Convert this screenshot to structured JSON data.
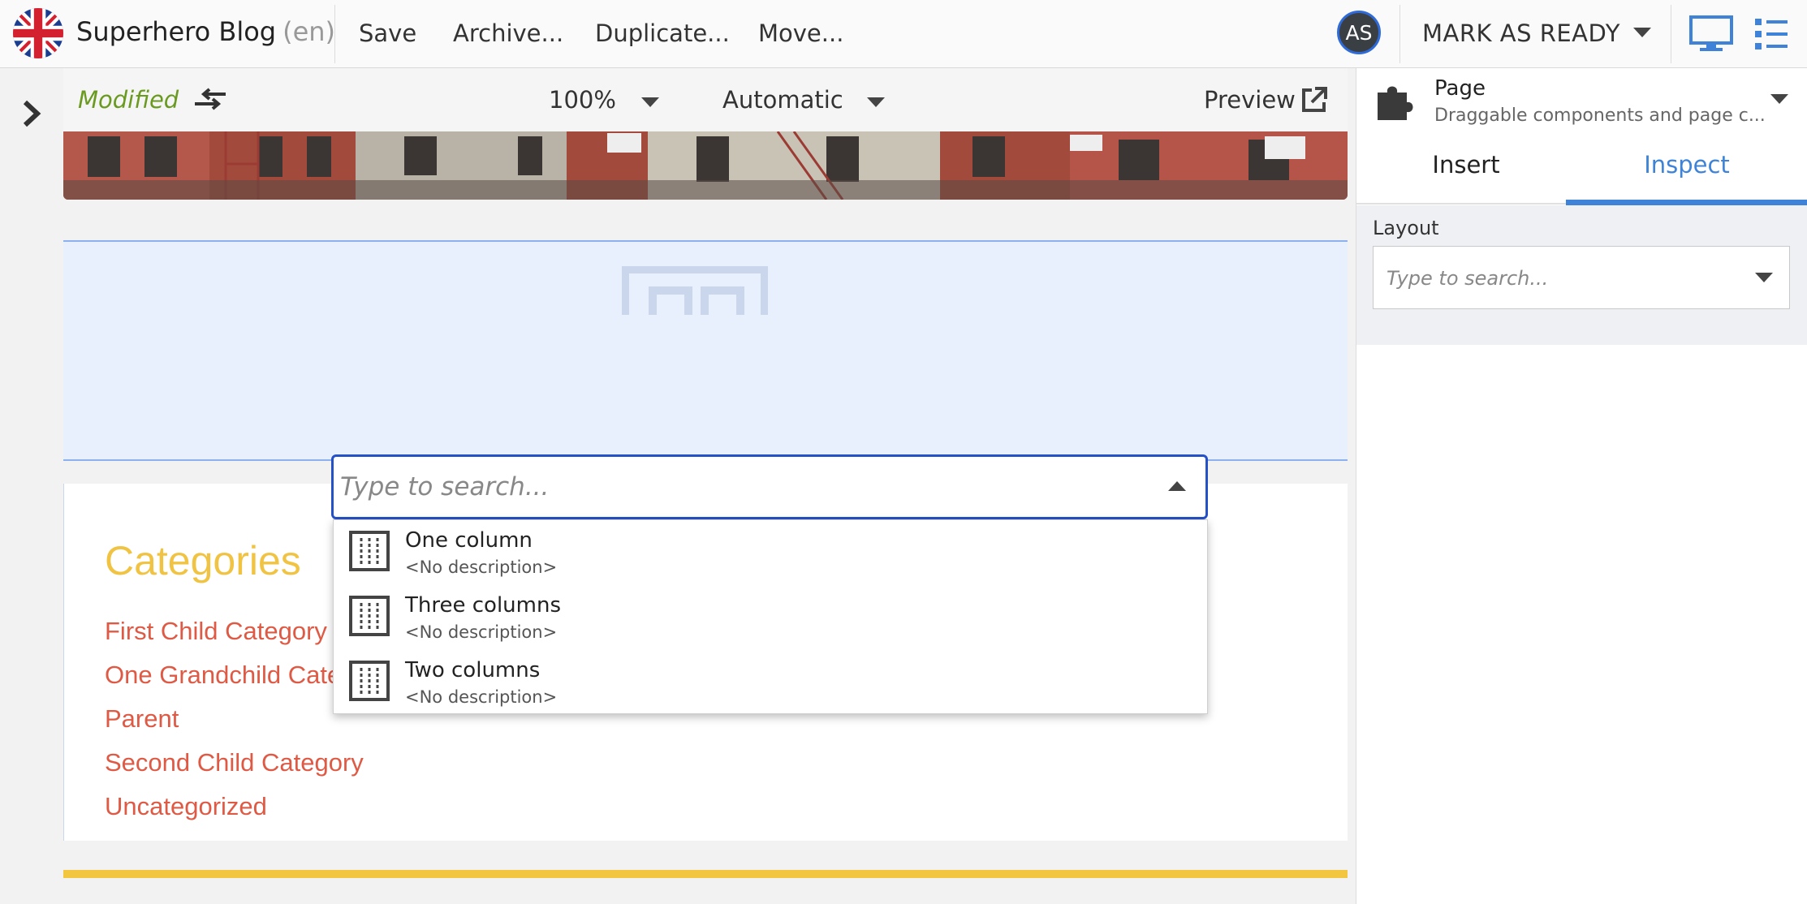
{
  "header": {
    "site_title": "Superhero Blog",
    "site_lang": "(en)",
    "actions": {
      "save": "Save",
      "archive": "Archive...",
      "duplicate": "Duplicate...",
      "move": "Move..."
    },
    "avatar_initials": "AS",
    "mark_ready": "MARK AS READY"
  },
  "canvas_toolbar": {
    "status": "Modified",
    "zoom": "100%",
    "device": "Automatic",
    "preview": "Preview"
  },
  "layout_picker": {
    "placeholder": "Type to search...",
    "options": [
      {
        "title": "One column",
        "description": "<No description>"
      },
      {
        "title": "Three columns",
        "description": "<No description>"
      },
      {
        "title": "Two columns",
        "description": "<No description>"
      }
    ]
  },
  "content": {
    "heading": "Categories",
    "links": [
      "First Child Category",
      "One Grandchild Category",
      "Parent",
      "Second Child Category",
      "Uncategorized"
    ]
  },
  "right_panel": {
    "component_title": "Page",
    "component_desc": "Draggable components and page c...",
    "tabs": {
      "insert": "Insert",
      "inspect": "Inspect"
    },
    "layout_label": "Layout",
    "layout_placeholder": "Type to search..."
  },
  "colors": {
    "accent_blue": "#3e83d8",
    "modified_green": "#6a9a1f",
    "category_heading": "#f1c342",
    "category_link": "#de5a45"
  }
}
